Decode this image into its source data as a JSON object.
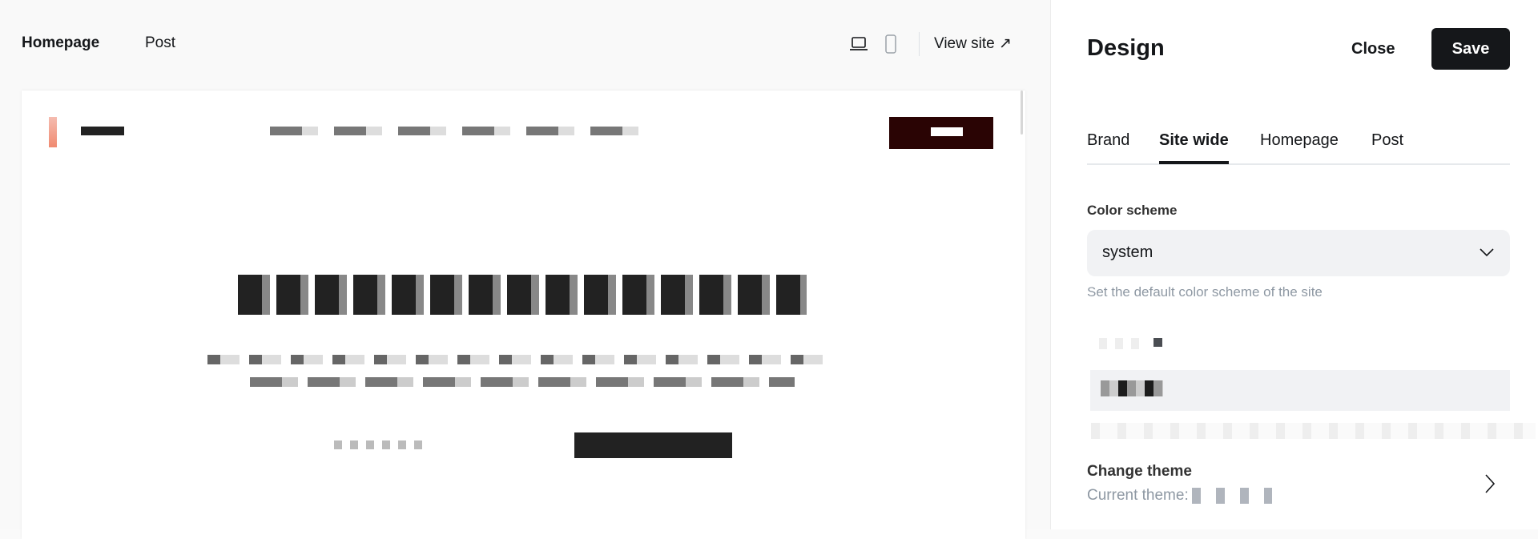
{
  "preview": {
    "tabs": [
      {
        "label": "Homepage",
        "active": true
      },
      {
        "label": "Post",
        "active": false
      }
    ],
    "view_site": "View site",
    "device_icons": [
      "laptop-icon",
      "mobile-icon"
    ]
  },
  "panel": {
    "title": "Design",
    "close_label": "Close",
    "save_label": "Save",
    "tabs": [
      {
        "label": "Brand"
      },
      {
        "label": "Site wide",
        "active": true
      },
      {
        "label": "Homepage"
      },
      {
        "label": "Post"
      }
    ],
    "color_scheme": {
      "label": "Color scheme",
      "value": "system",
      "help": "Set the default color scheme of the site"
    },
    "change_theme": {
      "label": "Change theme",
      "current_prefix": "Current theme:"
    }
  },
  "colors": {
    "accent": "#15171a",
    "brand_button": "#2a0404",
    "logo": "#f28b74"
  }
}
